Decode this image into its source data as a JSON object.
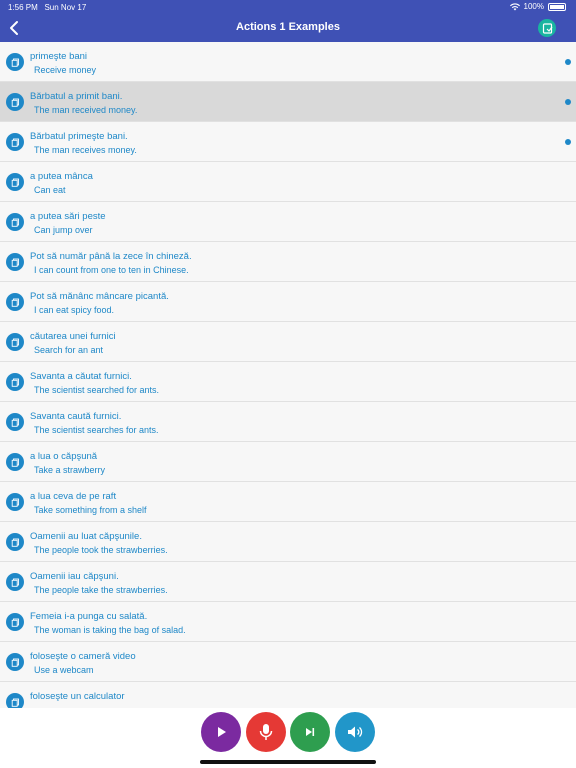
{
  "status": {
    "time": "1:56 PM",
    "date": "Sun Nov 17",
    "battery": "100%"
  },
  "header": {
    "title": "Actions 1 Examples"
  },
  "items": [
    {
      "ro": "primeşte bani",
      "en": "Receive money",
      "dot": true,
      "selected": false
    },
    {
      "ro": "Bărbatul a primit bani.",
      "en": "The man received money.",
      "dot": true,
      "selected": true
    },
    {
      "ro": "Bărbatul primeşte bani.",
      "en": "The man receives money.",
      "dot": true,
      "selected": false
    },
    {
      "ro": "a putea mânca",
      "en": "Can eat",
      "dot": false,
      "selected": false
    },
    {
      "ro": "a putea sări peste",
      "en": "Can jump over",
      "dot": false,
      "selected": false
    },
    {
      "ro": "Pot să număr până la zece în chineză.",
      "en": "I can count from one to ten in Chinese.",
      "dot": false,
      "selected": false
    },
    {
      "ro": "Pot să mănânc mâncare picantă.",
      "en": "I can eat spicy food.",
      "dot": false,
      "selected": false
    },
    {
      "ro": "căutarea unei furnici",
      "en": "Search for an ant",
      "dot": false,
      "selected": false
    },
    {
      "ro": "Savanta a căutat furnici.",
      "en": "The scientist searched for ants.",
      "dot": false,
      "selected": false
    },
    {
      "ro": "Savanta caută furnici.",
      "en": "The scientist searches for ants.",
      "dot": false,
      "selected": false
    },
    {
      "ro": "a lua o căpşună",
      "en": "Take a strawberry",
      "dot": false,
      "selected": false
    },
    {
      "ro": "a lua ceva de pe raft",
      "en": "Take something from a shelf",
      "dot": false,
      "selected": false
    },
    {
      "ro": "Oamenii au luat căpşunile.",
      "en": "The people took the strawberries.",
      "dot": false,
      "selected": false
    },
    {
      "ro": "Oamenii iau căpşuni.",
      "en": "The people take the strawberries.",
      "dot": false,
      "selected": false
    },
    {
      "ro": "Femeia i-a punga cu salată.",
      "en": "The woman is taking the bag of salad.",
      "dot": false,
      "selected": false
    },
    {
      "ro": "foloseşte o cameră video",
      "en": "Use a webcam",
      "dot": false,
      "selected": false
    },
    {
      "ro": "foloseşte un calculator",
      "en": "",
      "dot": false,
      "selected": false
    }
  ],
  "controls": [
    {
      "name": "play-button",
      "icon": "play-icon",
      "color": "#7b2aa0"
    },
    {
      "name": "record-button",
      "icon": "microphone-icon",
      "color": "#e53935"
    },
    {
      "name": "next-button",
      "icon": "skip-next-icon",
      "color": "#2e9e4f"
    },
    {
      "name": "speaker-button",
      "icon": "speaker-icon",
      "color": "#2196c9"
    }
  ],
  "colors": {
    "header": "#3f51b5",
    "accent": "#1e88c8",
    "bookmark": "#19b5a0"
  }
}
